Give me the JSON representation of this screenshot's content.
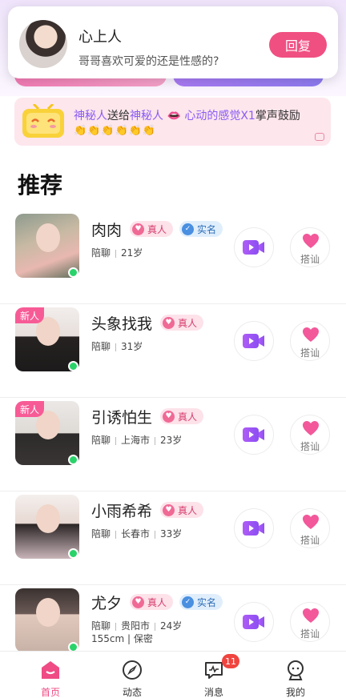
{
  "notification": {
    "name": "心上人",
    "message": "哥哥喜欢可爱的还是性感的?",
    "reply_label": "回复"
  },
  "gift_banner": {
    "sender": "神秘人",
    "verb": "送给",
    "receiver": "神秘人",
    "gift": "心动的感觉X1",
    "suffix": "掌声鼓励",
    "claps": "👏👏👏👏👏👏"
  },
  "section_title": "推荐",
  "chat_label": "搭讪",
  "real_tag": "真人",
  "verified_tag": "实名",
  "new_badge": "新人",
  "users": [
    {
      "name": "肉肉",
      "meta": [
        "陪聊",
        "21岁"
      ],
      "meta2": "",
      "real": true,
      "verified": true,
      "new": false
    },
    {
      "name": "头象找我",
      "meta": [
        "陪聊",
        "31岁"
      ],
      "meta2": "",
      "real": true,
      "verified": false,
      "new": true
    },
    {
      "name": "引诱怕生",
      "meta": [
        "陪聊",
        "上海市",
        "23岁"
      ],
      "meta2": "",
      "real": true,
      "verified": false,
      "new": true
    },
    {
      "name": "小雨希希",
      "meta": [
        "陪聊",
        "长春市",
        "33岁"
      ],
      "meta2": "",
      "real": true,
      "verified": false,
      "new": false
    },
    {
      "name": "尤夕",
      "meta": [
        "陪聊",
        "贵阳市",
        "24岁"
      ],
      "meta2": "155cm | 保密",
      "real": true,
      "verified": true,
      "new": false
    }
  ],
  "tabs": [
    {
      "label": "首页",
      "icon": "home-icon",
      "active": true
    },
    {
      "label": "动态",
      "icon": "compass-icon",
      "active": false
    },
    {
      "label": "消息",
      "icon": "message-icon",
      "active": false
    },
    {
      "label": "我的",
      "icon": "profile-icon",
      "active": false
    }
  ],
  "message_badge": "11",
  "colors": {
    "accent": "#f04f82",
    "purple": "#8a5cf5",
    "online": "#2ad36a"
  }
}
